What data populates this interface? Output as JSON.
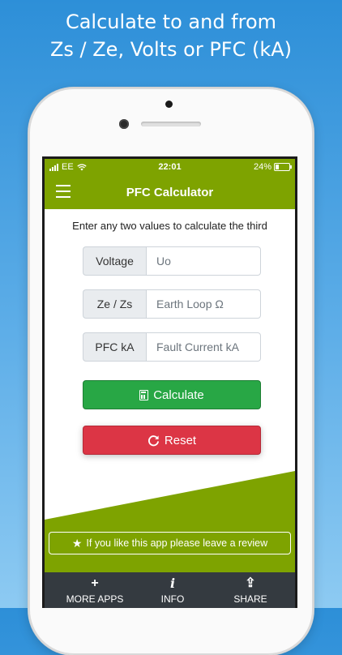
{
  "marketing": {
    "line1": "Calculate to and from",
    "line2": "Zs / Ze, Volts or PFC (kA)"
  },
  "status_bar": {
    "carrier": "EE",
    "time": "22:01",
    "battery": "24%"
  },
  "nav": {
    "title": "PFC Calculator"
  },
  "form": {
    "instruction": "Enter any two values to calculate the third",
    "fields": [
      {
        "label": "Voltage",
        "placeholder": "Uo"
      },
      {
        "label": "Ze / Zs",
        "placeholder": "Earth Loop Ω"
      },
      {
        "label": "PFC kA",
        "placeholder": "Fault Current kA"
      }
    ]
  },
  "buttons": {
    "calculate": "Calculate",
    "reset": "Reset"
  },
  "banner": {
    "star": "★",
    "text": "If you like this app please leave a review"
  },
  "tabs": [
    {
      "icon": "+",
      "label": "MORE APPS"
    },
    {
      "icon": "i",
      "label": "INFO"
    },
    {
      "icon": "⇪",
      "label": "SHARE"
    }
  ],
  "colors": {
    "brand_green": "#7ea300",
    "calculate": "#28a745",
    "reset": "#dc3545",
    "tabbar": "#343a40"
  }
}
